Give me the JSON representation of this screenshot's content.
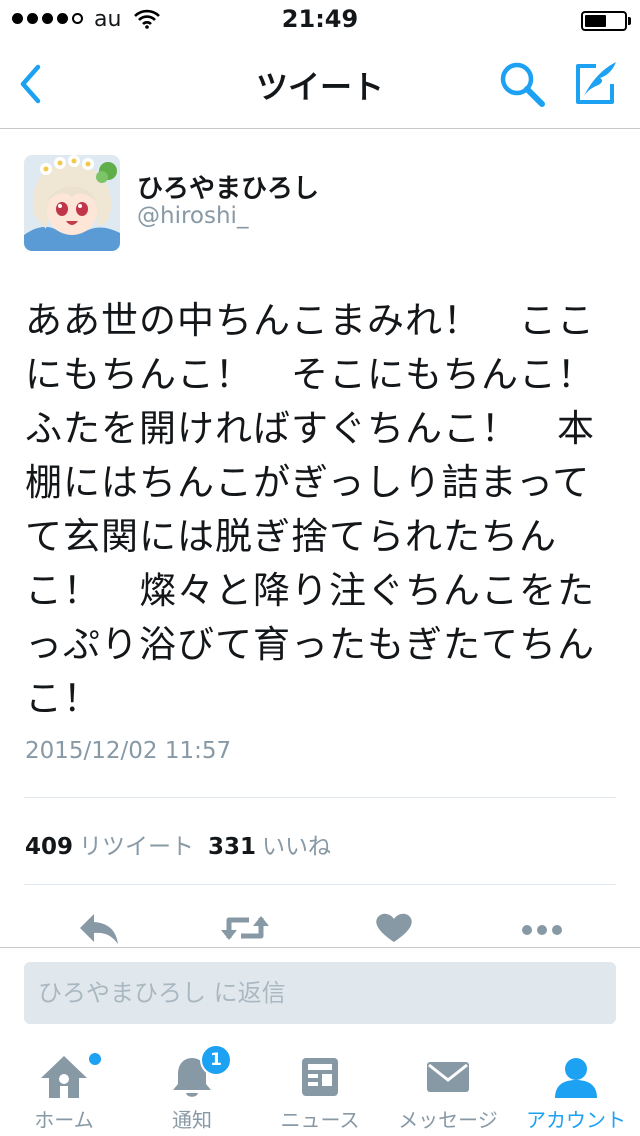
{
  "status_bar": {
    "carrier": "au",
    "time": "21:49",
    "signal_bars_filled": 4,
    "signal_bars_total": 5,
    "battery_level": 0.55
  },
  "nav": {
    "title": "ツイート",
    "back_icon": "chevron-left-icon",
    "search_icon": "search-icon",
    "compose_icon": "compose-tweet-icon"
  },
  "tweet": {
    "author_name": "ひろやまひろし",
    "author_handle": "@hiroshi_",
    "text": "ああ世の中ちんこまみれ！　ここにもちんこ！　そこにもちんこ！　ふたを開ければすぐちんこ！　本棚にはちんこがぎっしり詰まってて玄関には脱ぎ捨てられたちんこ！　燦々と降り注ぐちんこをたっぷり浴びて育ったもぎたてちんこ！",
    "timestamp": "2015/12/02 11:57",
    "retweets_count": "409",
    "retweets_label": "リツイート",
    "likes_count": "331",
    "likes_label": "いいね"
  },
  "actions": [
    "reply-icon",
    "retweet-icon",
    "like-icon",
    "more-icon"
  ],
  "reply": {
    "placeholder": "ひろやまひろし に返信"
  },
  "tabs": [
    {
      "label": "ホーム",
      "icon": "home-icon",
      "active": false
    },
    {
      "label": "通知",
      "icon": "bell-icon",
      "active": false,
      "badge": "1"
    },
    {
      "label": "ニュース",
      "icon": "news-icon",
      "active": false
    },
    {
      "label": "メッセージ",
      "icon": "envelope-icon",
      "active": false
    },
    {
      "label": "アカウント",
      "icon": "person-icon",
      "active": true
    }
  ],
  "colors": {
    "accent": "#1da1f2",
    "icon_gray": "#8899a6",
    "text": "#14171a"
  }
}
